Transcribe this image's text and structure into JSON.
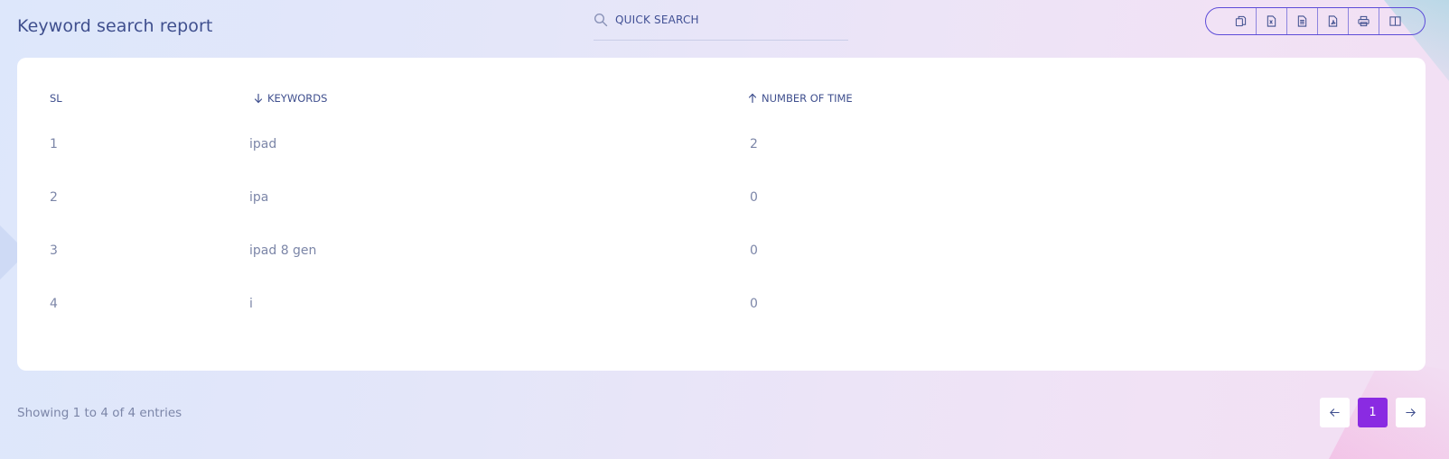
{
  "page": {
    "title": "Keyword search report"
  },
  "search": {
    "placeholder": "QUICK SEARCH"
  },
  "toolbar": {
    "export_buttons": [
      {
        "icon": "copy-icon"
      },
      {
        "icon": "excel-icon"
      },
      {
        "icon": "csv-icon"
      },
      {
        "icon": "pdf-icon"
      },
      {
        "icon": "print-icon"
      },
      {
        "icon": "columns-icon"
      }
    ]
  },
  "table": {
    "headers": {
      "sl": "SL",
      "keywords": "KEYWORDS",
      "count": "NUMBER OF TIME"
    },
    "rows": [
      {
        "sl": "1",
        "keyword": "ipad",
        "count": "2"
      },
      {
        "sl": "2",
        "keyword": "ipa",
        "count": "0"
      },
      {
        "sl": "3",
        "keyword": "ipad 8 gen",
        "count": "0"
      },
      {
        "sl": "4",
        "keyword": "i",
        "count": "0"
      }
    ]
  },
  "footer": {
    "info": "Showing 1 to 4 of 4 entries"
  },
  "pagination": {
    "current": "1"
  },
  "colors": {
    "accent": "#8a2be2",
    "border": "#5d4cd8",
    "text": "#415094",
    "muted": "#7c86a8"
  }
}
